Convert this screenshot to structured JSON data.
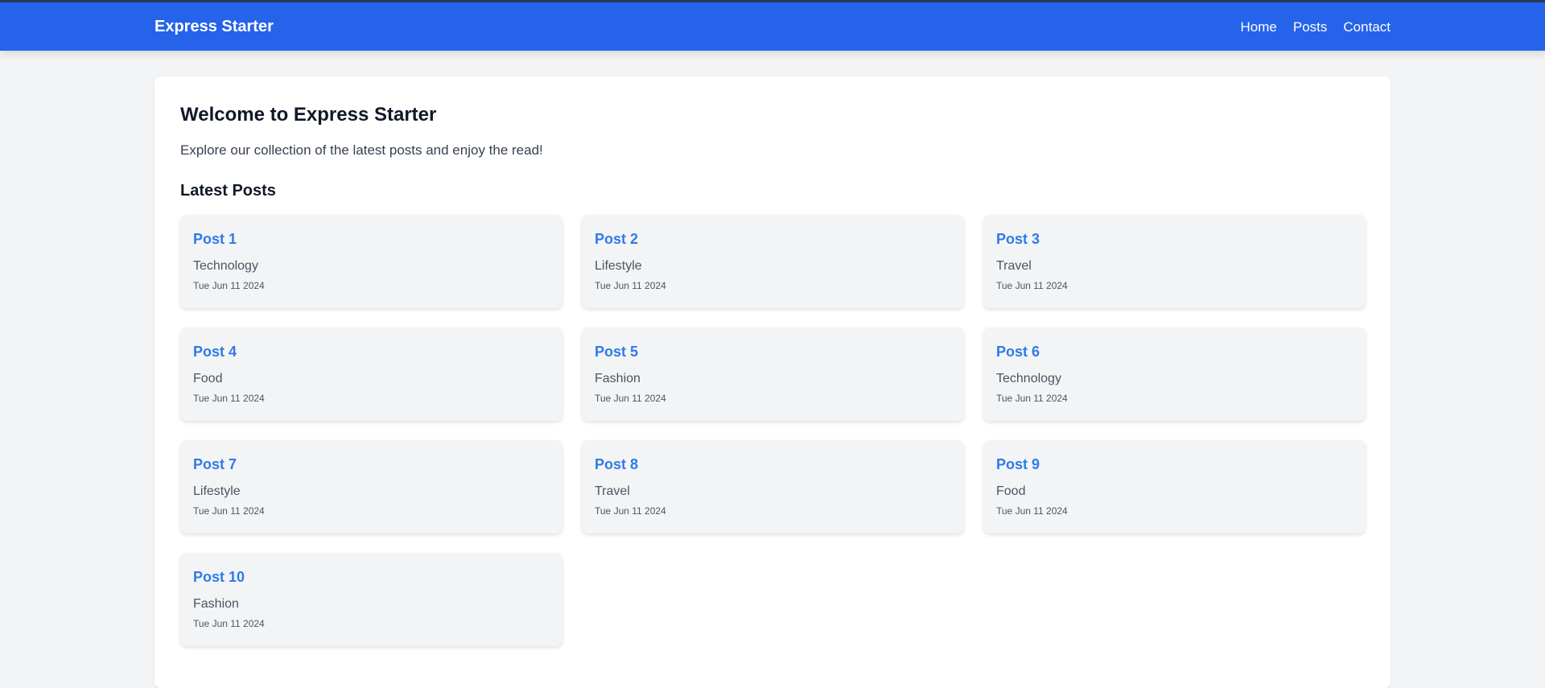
{
  "header": {
    "brand": "Express Starter",
    "nav": [
      {
        "label": "Home"
      },
      {
        "label": "Posts"
      },
      {
        "label": "Contact"
      }
    ]
  },
  "main": {
    "title": "Welcome to Express Starter",
    "intro": "Explore our collection of the latest posts and enjoy the read!",
    "section_title": "Latest Posts",
    "posts": [
      {
        "title": "Post 1",
        "category": "Technology",
        "date": "Tue Jun 11 2024"
      },
      {
        "title": "Post 2",
        "category": "Lifestyle",
        "date": "Tue Jun 11 2024"
      },
      {
        "title": "Post 3",
        "category": "Travel",
        "date": "Tue Jun 11 2024"
      },
      {
        "title": "Post 4",
        "category": "Food",
        "date": "Tue Jun 11 2024"
      },
      {
        "title": "Post 5",
        "category": "Fashion",
        "date": "Tue Jun 11 2024"
      },
      {
        "title": "Post 6",
        "category": "Technology",
        "date": "Tue Jun 11 2024"
      },
      {
        "title": "Post 7",
        "category": "Lifestyle",
        "date": "Tue Jun 11 2024"
      },
      {
        "title": "Post 8",
        "category": "Travel",
        "date": "Tue Jun 11 2024"
      },
      {
        "title": "Post 9",
        "category": "Food",
        "date": "Tue Jun 11 2024"
      },
      {
        "title": "Post 10",
        "category": "Fashion",
        "date": "Tue Jun 11 2024"
      }
    ]
  },
  "colors": {
    "header_bg": "#2563eb",
    "post_title": "#2f7be6",
    "page_bg": "#f3f4f6"
  }
}
